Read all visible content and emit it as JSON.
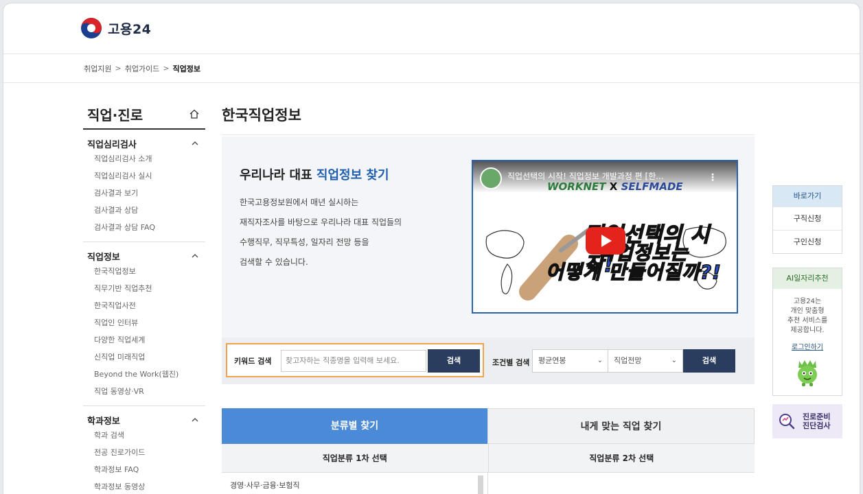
{
  "header": {
    "logo_text": "고용24"
  },
  "breadcrumb": {
    "items": [
      "취업지원",
      "취업가이드"
    ],
    "current": "직업정보",
    "separator": ">"
  },
  "sidebar": {
    "title": "직업·진로",
    "groups": [
      {
        "title": "직업심리검사",
        "items": [
          "직업심리검사 소개",
          "직업심리검사 실시",
          "검사결과 보기",
          "검사결과 상담",
          "검사결과 상담 FAQ"
        ]
      },
      {
        "title": "직업정보",
        "items": [
          "한국직업정보",
          "직무기반 직업추천",
          "한국직업사전",
          "직업인 인터뷰",
          "다양한 직업세계",
          "신직업 미래직업",
          "Beyond the Work(웹진)",
          "직업 동영상·VR"
        ]
      },
      {
        "title": "학과정보",
        "items": [
          "학과 검색",
          "전공 진로가이드",
          "학과정보 FAQ",
          "학과정보 동영상"
        ]
      }
    ]
  },
  "main": {
    "title": "한국직업정보",
    "intro": {
      "heading_prefix": "우리나라 대표 ",
      "heading_accent": "직업정보 찾기",
      "lines": [
        "한국고용정보원에서 매년 실시하는",
        "재직자조사를 바탕으로 우리나라 대표 직업들의",
        "수행직무, 직무특성, 일자리 전망 등을",
        "검색할 수 있습니다."
      ]
    },
    "video": {
      "title": "직업선택의 시작! 직업정보 개발과정 편 [한...",
      "brand_left": "WORKNET",
      "brand_x": "X",
      "brand_right": "SELFMADE",
      "overlay_line1": "직업선택의 시작!",
      "overlay_line2": "직업정보는",
      "overlay_line3": "어떻게 만들어질까?!"
    },
    "search": {
      "keyword_label": "키워드 검색",
      "keyword_placeholder": "찾고자하는 직종명을 입력해 보세요.",
      "keyword_button": "검색",
      "condition_label": "조건별 검색",
      "select1_value": "평균연봉",
      "select2_value": "직업전망",
      "condition_button": "검색"
    },
    "tabs": [
      {
        "label": "분류별 찾기",
        "active": true
      },
      {
        "label": "내게 맞는 직업 찾기",
        "active": false
      }
    ],
    "subheads": [
      "직업분류 1차 선택",
      "직업분류 2차 선택"
    ],
    "list_items": [
      "경영·사무·금융·보험직"
    ]
  },
  "quick_menu": {
    "head": "바로가기",
    "items": [
      "구직신청",
      "구인신청"
    ],
    "ai_head": "AI일자리추천",
    "ai_lines": [
      "고용24는",
      "개인 맞춤형",
      "추천 서비스를",
      "제공합니다."
    ],
    "ai_link": "로그인하기",
    "check_line1": "진로준비",
    "check_line2": "진단검사"
  },
  "colors": {
    "accent": "#1f5fae",
    "tab_active": "#4a8ad6",
    "button_dark": "#2b3d5e",
    "highlight_border": "#f0a34a"
  }
}
